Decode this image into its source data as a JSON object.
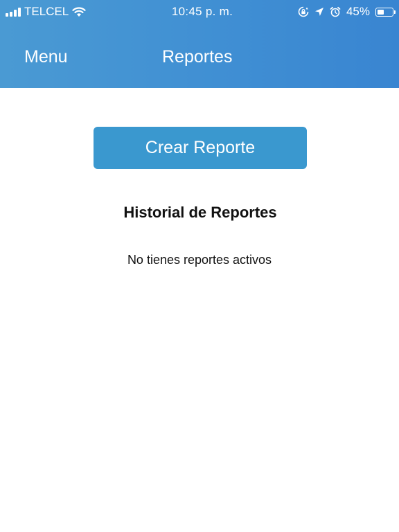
{
  "status_bar": {
    "carrier": "TELCEL",
    "time": "10:45 p. m.",
    "battery_percent": "45%",
    "battery_level": 0.45,
    "icons": [
      "signal-icon",
      "wifi-icon",
      "orientation-lock-icon",
      "location-icon",
      "alarm-icon",
      "battery-icon"
    ]
  },
  "nav": {
    "menu_label": "Menu",
    "title": "Reportes"
  },
  "main": {
    "create_button_label": "Crear Reporte",
    "history_title": "Historial de Reportes",
    "empty_message": "No tienes reportes activos"
  },
  "colors": {
    "header": "#3f8ed3",
    "button": "#3a98cf",
    "text": "#111111",
    "background": "#ffffff"
  }
}
